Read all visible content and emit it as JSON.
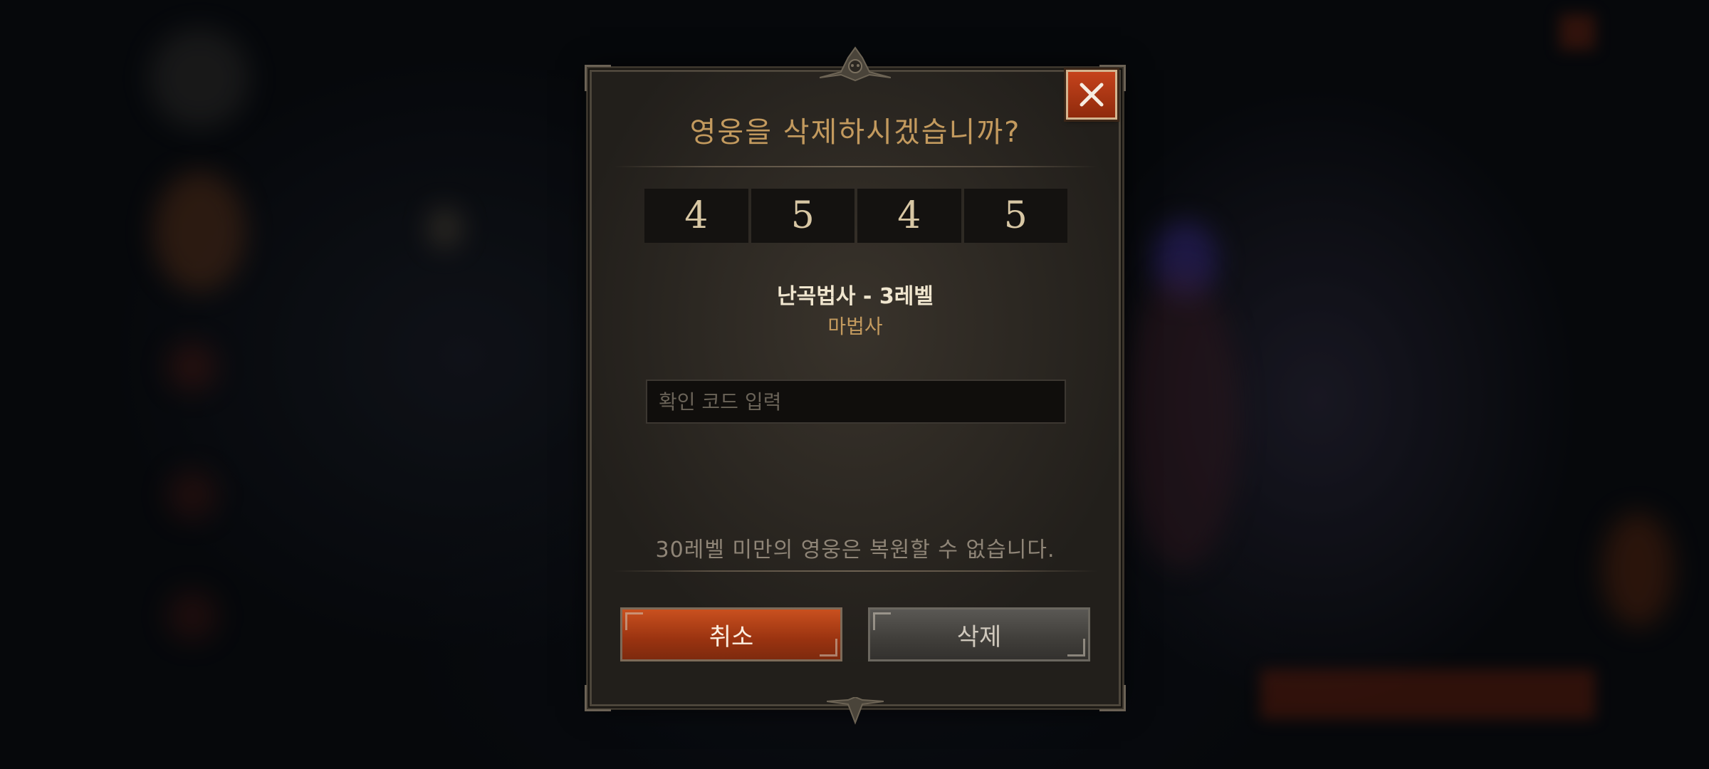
{
  "dialog": {
    "title": "영웅을 삭제하시겠습니까?",
    "code_digits": [
      "4",
      "5",
      "4",
      "5"
    ],
    "hero_name": "난곡법사 - 3레벨",
    "hero_class": "마법사",
    "input_placeholder": "확인 코드 입력",
    "input_value": "",
    "notice": "30레벨 미만의 영웅은 복원할 수 없습니다.",
    "cancel_label": "취소",
    "delete_label": "삭제",
    "close_icon": "close-icon"
  },
  "colors": {
    "title": "#c39a5e",
    "cancel_button": "#b2431a",
    "delete_button": "#4a4844",
    "close_button": "#b33a17"
  }
}
